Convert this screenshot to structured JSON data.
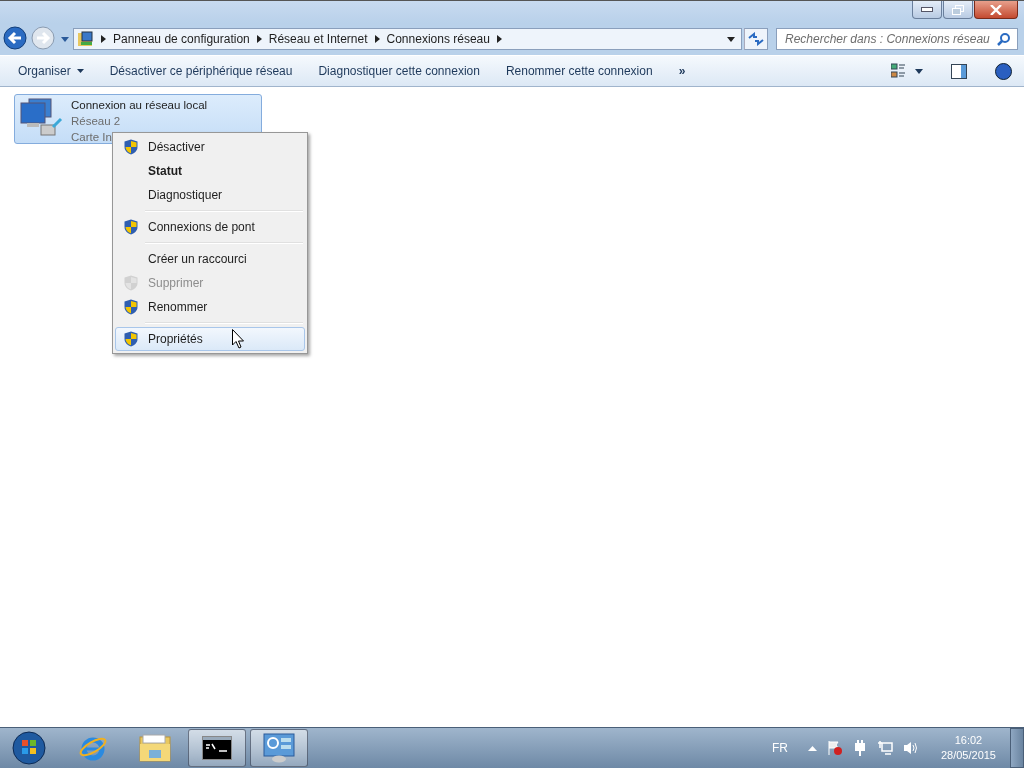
{
  "address_bar": {
    "breadcrumbs": [
      "Panneau de configuration",
      "Réseau et Internet",
      "Connexions réseau"
    ]
  },
  "search": {
    "placeholder": "Rechercher dans : Connexions réseau"
  },
  "toolbar": {
    "items": [
      "Organiser",
      "Désactiver ce périphérique réseau",
      "Diagnostiquer cette connexion",
      "Renommer cette connexion"
    ],
    "more": "»"
  },
  "connection": {
    "name": "Connexion au réseau local",
    "network": "Réseau  2",
    "adapter": "Carte In",
    "selected": true
  },
  "context_menu": {
    "groups": [
      {
        "items": [
          {
            "label": "Désactiver",
            "shield": true,
            "bold": false,
            "disabled": false,
            "selected": false
          },
          {
            "label": "Statut",
            "shield": false,
            "bold": true,
            "disabled": false,
            "selected": false
          },
          {
            "label": "Diagnostiquer",
            "shield": false,
            "bold": false,
            "disabled": false,
            "selected": false
          }
        ]
      },
      {
        "items": [
          {
            "label": "Connexions de pont",
            "shield": true,
            "bold": false,
            "disabled": false,
            "selected": false
          }
        ]
      },
      {
        "items": [
          {
            "label": "Créer un raccourci",
            "shield": false,
            "bold": false,
            "disabled": false,
            "selected": false
          },
          {
            "label": "Supprimer",
            "shield": true,
            "bold": false,
            "disabled": true,
            "selected": false
          },
          {
            "label": "Renommer",
            "shield": true,
            "bold": false,
            "disabled": false,
            "selected": false
          }
        ]
      },
      {
        "items": [
          {
            "label": "Propriétés",
            "shield": true,
            "bold": false,
            "disabled": false,
            "selected": true
          }
        ]
      }
    ]
  },
  "taskbar": {
    "apps": [
      {
        "kind": "browser",
        "running": false
      },
      {
        "kind": "folder",
        "running": false
      },
      {
        "kind": "console",
        "running": true
      },
      {
        "kind": "control-panel",
        "running": true
      }
    ],
    "language": "FR",
    "time": "16:02",
    "date": "28/05/2015"
  }
}
